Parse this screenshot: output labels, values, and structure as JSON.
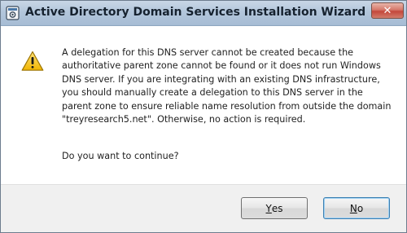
{
  "window": {
    "title": "Active Directory Domain Services Installation Wizard",
    "close_glyph": "✕",
    "app_icon": "adds-wizard-icon"
  },
  "message": {
    "icon": "warning-icon",
    "body": "A delegation for this DNS server cannot be created because the authoritative parent zone cannot be found or it does not run Windows DNS server. If you are integrating with an existing DNS infrastructure, you should manually create a delegation to this DNS server in the parent zone to ensure reliable name resolution from outside the domain \"treyresearch5.net\". Otherwise, no action is required.",
    "question": "Do you want to continue?"
  },
  "buttons": {
    "yes": {
      "accel": "Y",
      "rest": "es"
    },
    "no": {
      "accel": "N",
      "rest": "o"
    }
  }
}
